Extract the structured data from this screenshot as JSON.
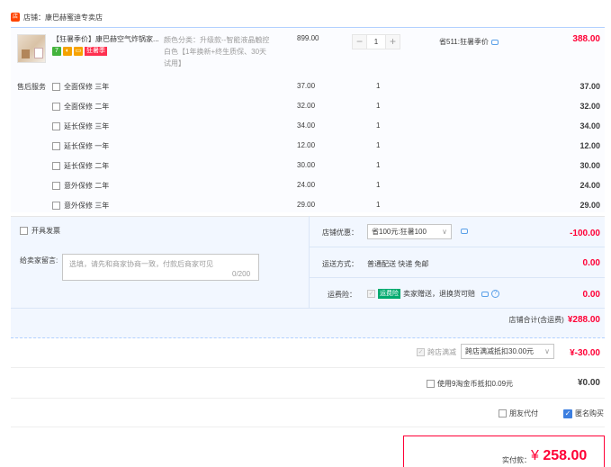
{
  "shop": {
    "label": "店铺：",
    "name": "康巴赫蜜迪专卖店"
  },
  "product": {
    "title": "【狂暑季价】康巴赫空气炸锅家...",
    "badge_text": "狂暑季",
    "spec": "颜色分类：升级款--智能液晶触控白色【1年换新+终生质保、30天试用】",
    "price": "899.00",
    "quantity": "1",
    "minus": "−",
    "plus": "+",
    "savings": "省511:狂暑季价",
    "subtotal": "388.00"
  },
  "service": {
    "label": "售后服务",
    "items": [
      {
        "name": "全面保修 三年",
        "price": "37.00",
        "qty": "1",
        "total": "37.00"
      },
      {
        "name": "全面保修 二年",
        "price": "32.00",
        "qty": "1",
        "total": "32.00"
      },
      {
        "name": "延长保修 三年",
        "price": "34.00",
        "qty": "1",
        "total": "34.00"
      },
      {
        "name": "延长保修 一年",
        "price": "12.00",
        "qty": "1",
        "total": "12.00"
      },
      {
        "name": "延长保修 二年",
        "price": "30.00",
        "qty": "1",
        "total": "30.00"
      },
      {
        "name": "意外保修 二年",
        "price": "24.00",
        "qty": "1",
        "total": "24.00"
      },
      {
        "name": "意外保修 三年",
        "price": "29.00",
        "qty": "1",
        "total": "29.00"
      }
    ]
  },
  "invoice": {
    "label": "开具发票"
  },
  "message": {
    "label": "给卖家留言:",
    "placeholder": "选填，请先和商家协商一致，付款后商家可见",
    "count": "0/200"
  },
  "discount": {
    "label": "店铺优惠：",
    "selected": "省100元:狂暑100",
    "amount": "-100.00"
  },
  "shipping": {
    "label": "运送方式：",
    "text": "普通配送 快递 免邮",
    "amount": "0.00"
  },
  "insurance": {
    "label": "运费险：",
    "tag": "运费险",
    "text": "卖家赠送，退换货可赔",
    "amount": "0.00"
  },
  "shop_total": {
    "label": "店铺合计(含运费)",
    "amount": "¥288.00"
  },
  "cross_store": {
    "label": "跨店满减",
    "selected": "跨店满减抵扣30.00元",
    "amount": "¥-30.00"
  },
  "coins": {
    "label": "使用9淘金币抵扣0.09元",
    "amount": "¥0.00"
  },
  "options": {
    "friend_pay": "朋友代付",
    "anonymous": "匿名购买"
  },
  "payment": {
    "label": "实付款：",
    "currency": "¥",
    "amount": "258.00"
  },
  "colors": {
    "accent": "#ff0036",
    "link_blue": "#3d7fe0",
    "panel": "#f2f7ff"
  }
}
